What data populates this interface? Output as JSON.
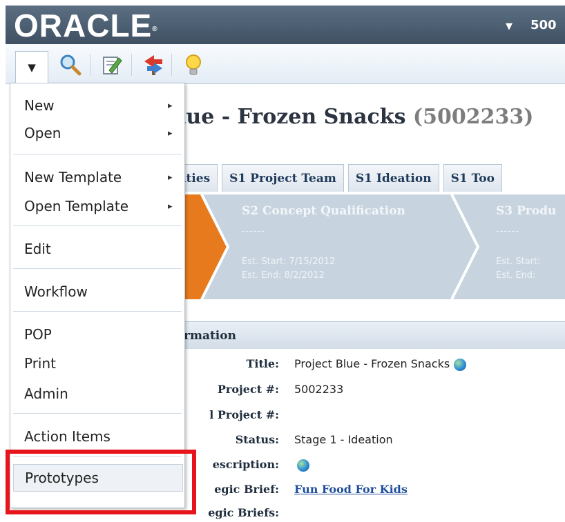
{
  "header": {
    "logo": "ORACLE",
    "user_fragment": "500"
  },
  "toolbar": {
    "dropdown_icon": "caret-down-icon",
    "buttons": [
      "search-icon",
      "edit-icon",
      "directions-icon",
      "lightbulb-icon"
    ]
  },
  "page": {
    "title": "lue - Frozen Snacks",
    "number": "(5002233)"
  },
  "tabs": [
    "ities",
    "S1 Project Team",
    "S1 Ideation",
    "S1 Too"
  ],
  "stages": [
    {
      "name": "S2 Concept Qualification",
      "dash": "------",
      "start": "Est. Start:  7/15/2012",
      "end": "Est. End:  8/2/2012"
    },
    {
      "name": "S3 Produ",
      "dash": "------",
      "start": "Est. Start:",
      "end": "Est. End:"
    }
  ],
  "info": {
    "heading": "rmation",
    "rows": [
      {
        "label": "Title:",
        "value": "Project Blue - Frozen Snacks"
      },
      {
        "label": "Project #:",
        "value": "5002233"
      },
      {
        "label": "l Project #:",
        "value": ""
      },
      {
        "label": "Status:",
        "value": "Stage 1 - Ideation"
      },
      {
        "label": "escription:",
        "value": ""
      },
      {
        "label": "egic Brief:",
        "value": "Fun Food For Kids"
      },
      {
        "label": "egic Briefs:",
        "value": ""
      }
    ]
  },
  "menu": {
    "items": [
      {
        "label": "New",
        "submenu": "▸"
      },
      {
        "label": "Open",
        "submenu": "▸"
      },
      {
        "label": "New Template",
        "submenu": "▸"
      },
      {
        "label": "Open Template",
        "submenu": "▸"
      },
      {
        "label": "Edit"
      },
      {
        "label": "Workflow"
      },
      {
        "label": "POP"
      },
      {
        "label": "Print"
      },
      {
        "label": "Admin"
      },
      {
        "label": "Action Items"
      },
      {
        "label": "Prototypes"
      }
    ]
  },
  "colors": {
    "header": "#4a5b6e",
    "highlight_box": "#e8141b",
    "stage_band": "#c7d4df",
    "active_stage": "#e87a1e",
    "link": "#1f4f9c"
  }
}
